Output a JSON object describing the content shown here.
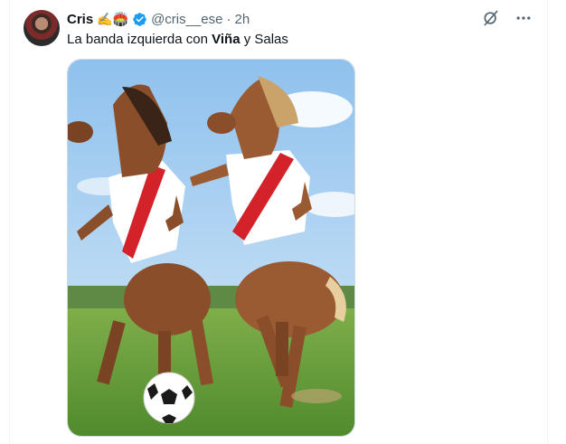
{
  "tweet": {
    "display_name": "Cris",
    "emojis": "✍️🏟️",
    "handle": "@cris__ese",
    "separator": "·",
    "time": "2h",
    "text_before": "La banda izquierda con ",
    "text_bold": "Viña",
    "text_after": " y Salas"
  },
  "icons": {
    "verified": "verified-badge-icon",
    "grok": "grok-icon",
    "more": "more-icon"
  },
  "colors": {
    "verified_blue": "#1d9bf0",
    "secondary_text": "#536471",
    "jersey_red": "#d3222a"
  }
}
